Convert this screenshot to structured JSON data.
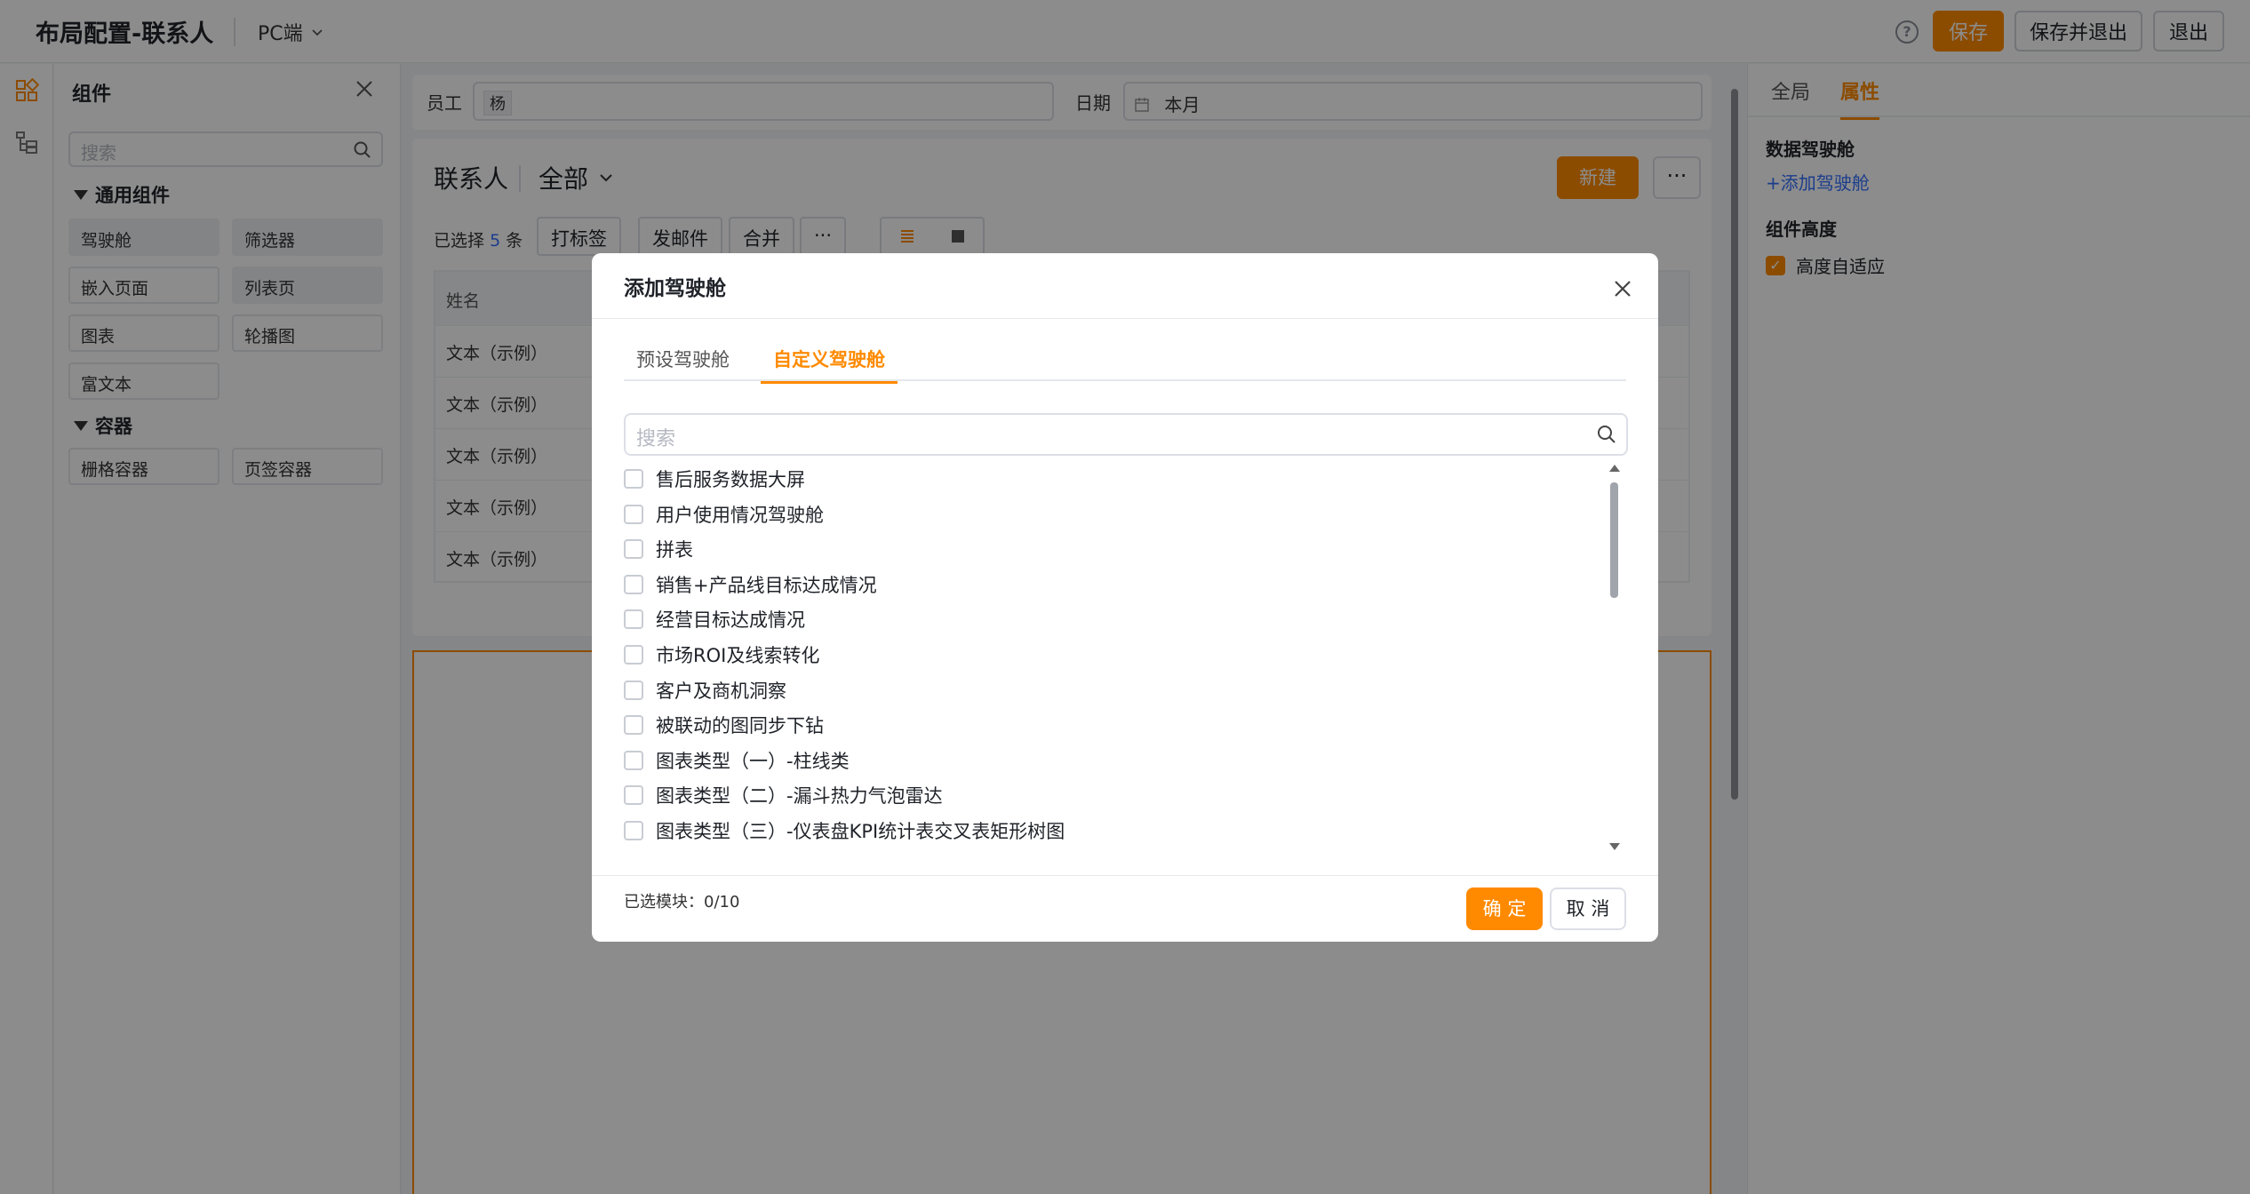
{
  "header": {
    "title": "布局配置-联系人",
    "device": "PC端",
    "help": "?",
    "save_label": "保存",
    "save_exit_label": "保存并退出",
    "exit_label": "退出"
  },
  "components": {
    "title": "组件",
    "search_placeholder": "搜索",
    "groups": [
      {
        "name": "通用组件",
        "items": [
          "驾驶舱",
          "筛选器",
          "嵌入页面",
          "列表页",
          "图表",
          "轮播图",
          "富文本"
        ]
      },
      {
        "name": "容器",
        "items": [
          "栅格容器",
          "页签容器"
        ]
      }
    ]
  },
  "canvas": {
    "filters": {
      "employee_label": "员工",
      "employee_value": "杨",
      "date_label": "日期",
      "date_value": "本月"
    },
    "list": {
      "title": "联系人",
      "scope": "全部",
      "new_label": "新建",
      "more": "···",
      "selected_prefix": "已选择",
      "selected_count": "5",
      "selected_suffix": "条",
      "actions": [
        "打标签",
        "发邮件",
        "合并",
        "···"
      ],
      "column": "姓名",
      "rows": [
        "文本（示例）",
        "文本（示例）",
        "文本（示例）",
        "文本（示例）",
        "文本（示例）"
      ]
    }
  },
  "right_panel": {
    "tabs": [
      "全局",
      "属性"
    ],
    "active_tab": "属性",
    "section_cockpit": "数据驾驶舱",
    "add_cockpit_link": "+添加驾驶舱",
    "section_height": "组件高度",
    "height_auto_label": "高度自适应",
    "height_auto_checked": true
  },
  "modal": {
    "title": "添加驾驶舱",
    "tabs": [
      "预设驾驶舱",
      "自定义驾驶舱"
    ],
    "active_tab": "自定义驾驶舱",
    "search_placeholder": "搜索",
    "items": [
      "售后服务数据大屏",
      "用户使用情况驾驶舱",
      "拼表",
      "销售+产品线目标达成情况",
      "经营目标达成情况",
      "市场ROI及线索转化",
      "客户及商机洞察",
      "被联动的图同步下钻",
      "图表类型（一）-柱线类",
      "图表类型（二）-漏斗热力气泡雷达",
      "图表类型（三）-仪表盘KPI统计表交叉表矩形树图"
    ],
    "selected_label": "已选模块：0/10",
    "ok_label": "确 定",
    "cancel_label": "取 消"
  },
  "colors": {
    "accent": "#ff8a00",
    "link": "#3370ff"
  }
}
